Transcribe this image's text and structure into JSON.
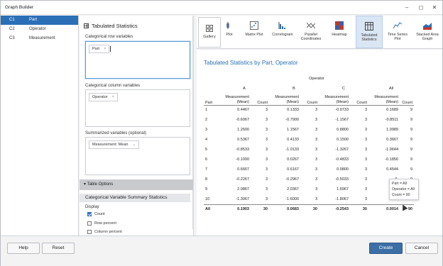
{
  "window": {
    "title": "Graph Builder"
  },
  "columns": [
    {
      "num": "C1",
      "label": "Part",
      "selected": true
    },
    {
      "num": "C2",
      "label": "Operator",
      "selected": false
    },
    {
      "num": "C3",
      "label": "Measurement",
      "selected": false
    }
  ],
  "variables": {
    "heading": "Tabulated Statistics",
    "row_label": "Categorical row variables",
    "row_chip": "Part",
    "col_label": "Categorical column variables",
    "col_chip": "Operator",
    "sum_label": "Summarized variables (optional)",
    "sum_chip": "Measurement: Mean"
  },
  "options": {
    "header": "Table Options",
    "sub": "Categorical Variable Summary Statistics",
    "display_label": "Display",
    "checks": [
      {
        "label": "Count",
        "checked": true
      },
      {
        "label": "Row percent",
        "checked": false
      },
      {
        "label": "Column percent",
        "checked": false
      }
    ]
  },
  "gallery": {
    "button": "Gallery",
    "tools": [
      {
        "label": "Plot",
        "icon": "box-plot-icon"
      },
      {
        "label": "Matrix Plot",
        "icon": "matrix-plot-icon"
      },
      {
        "label": "Correlogram",
        "icon": "correlogram-icon"
      },
      {
        "label": "Parallel Coordinates",
        "icon": "parallel-coordinates-icon"
      },
      {
        "label": "Heatmap",
        "icon": "heatmap-icon"
      },
      {
        "label": "Tabulated Statistics",
        "icon": "tabulated-statistics-icon"
      },
      {
        "label": "Time Series Plot",
        "icon": "time-series-icon"
      },
      {
        "label": "Stacked Area Graph",
        "icon": "stacked-area-icon"
      }
    ]
  },
  "report": {
    "title": "Tabulated Statistics by Part, Operator",
    "operator_header": "Operator",
    "groups": [
      "A",
      "B",
      "C",
      "All"
    ],
    "col_part": "Part",
    "col_mean": "Measurement (Mean)",
    "col_count": "Count",
    "rows": [
      {
        "part": "1",
        "cells": [
          "0.4467",
          "3",
          "0.1333",
          "3",
          "-0.0733",
          "3",
          "0.1689",
          "9"
        ]
      },
      {
        "part": "2",
        "cells": [
          "-0.6067",
          "3",
          "-0.7900",
          "3",
          "-1.1567",
          "3",
          "-0.8511",
          "9"
        ]
      },
      {
        "part": "3",
        "cells": [
          "1.2600",
          "3",
          "1.1567",
          "3",
          "0.8800",
          "3",
          "1.0989",
          "9"
        ]
      },
      {
        "part": "4",
        "cells": [
          "0.5367",
          "3",
          "0.4133",
          "3",
          "0.1500",
          "3",
          "0.3667",
          "9"
        ]
      },
      {
        "part": "5",
        "cells": [
          "-0.8533",
          "3",
          "-1.0133",
          "3",
          "-1.3267",
          "3",
          "-1.0644",
          "9"
        ]
      },
      {
        "part": "6",
        "cells": [
          "-0.1000",
          "3",
          "0.0267",
          "3",
          "-0.4833",
          "3",
          "-0.1856",
          "9"
        ]
      },
      {
        "part": "7",
        "cells": [
          "0.6667",
          "3",
          "0.6167",
          "3",
          "0.0800",
          "3",
          "0.4544",
          "9"
        ]
      },
      {
        "part": "8",
        "cells": [
          "-0.2267",
          "3",
          "-0.2967",
          "3",
          "-0.5033",
          "3",
          "-0.",
          "9"
        ]
      },
      {
        "part": "9",
        "cells": [
          "2.0867",
          "3",
          "2.0367",
          "3",
          "1.6967",
          "3",
          "",
          "9"
        ]
      },
      {
        "part": "10",
        "cells": [
          "-1.3067",
          "3",
          "-1.6000",
          "3",
          "-1.8067",
          "3",
          "-1.",
          "9"
        ]
      }
    ],
    "total": {
      "part": "All",
      "cells": [
        "0.1903",
        "30",
        "0.0683",
        "30",
        "-0.2543",
        "30",
        "0.0014",
        "90"
      ]
    }
  },
  "tooltip": {
    "line1": "Part = All",
    "line2": "Operator = All",
    "line3": "Count = 90"
  },
  "footer": {
    "help": "Help",
    "reset": "Reset",
    "create": "Create",
    "cancel": "Cancel"
  }
}
